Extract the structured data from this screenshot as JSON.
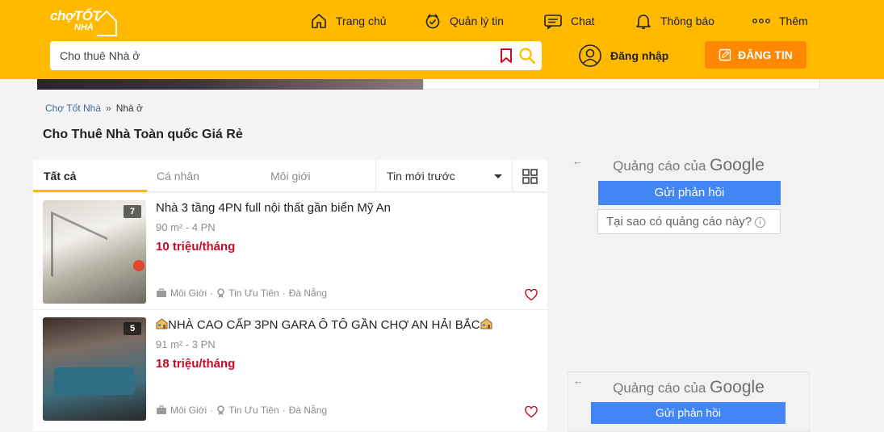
{
  "header": {
    "logo_line1": "chợTỐT",
    "logo_line2": "NHÀ",
    "nav": {
      "home": "Trang chủ",
      "manage": "Quản lý tin",
      "chat": "Chat",
      "notify": "Thông báo",
      "more": "Thêm"
    },
    "search_placeholder": "Cho thuê Nhà ở",
    "login": "Đăng nhập",
    "post": "ĐĂNG TIN",
    "accent": "#ffba00"
  },
  "breadcrumb": [
    "Chợ Tốt Nhà",
    "»",
    "Nhà ở"
  ],
  "page_title": "Cho Thuê Nhà Toàn quốc Giá Rẻ",
  "tabs": {
    "all": "Tất cả",
    "personal": "Cá nhân",
    "agent": "Môi giới",
    "sort": "Tin mới trước"
  },
  "listings": [
    {
      "title": "Nhà 3 tầng 4PN full nội thất gần biển Mỹ An",
      "meta": "90 m² - 4 PN",
      "price": "10 triệu/tháng",
      "images": "7",
      "seller": "Môi Giới",
      "badge": "Tin Ưu Tiên",
      "location": "Đà Nẵng"
    },
    {
      "title": "NHÀ CAO CẤP 3PN GARA Ô TÔ GẦN CHỢ AN HẢI BẮC",
      "meta": "91 m² - 3 PN",
      "price": "18 triệu/tháng",
      "images": "5",
      "seller": "Môi Giới",
      "badge": "Tin Ưu Tiên",
      "location": "Đà Nẵng"
    }
  ],
  "ads": {
    "label": "Quảng cáo của",
    "brand": "Google",
    "feedback": "Gửi phản hồi",
    "why": "Tại sao có quảng cáo này?",
    "back": "←"
  },
  "colors": {
    "price": "#c90927",
    "post_button": "#ff8800",
    "ad_button": "#4285f4"
  }
}
